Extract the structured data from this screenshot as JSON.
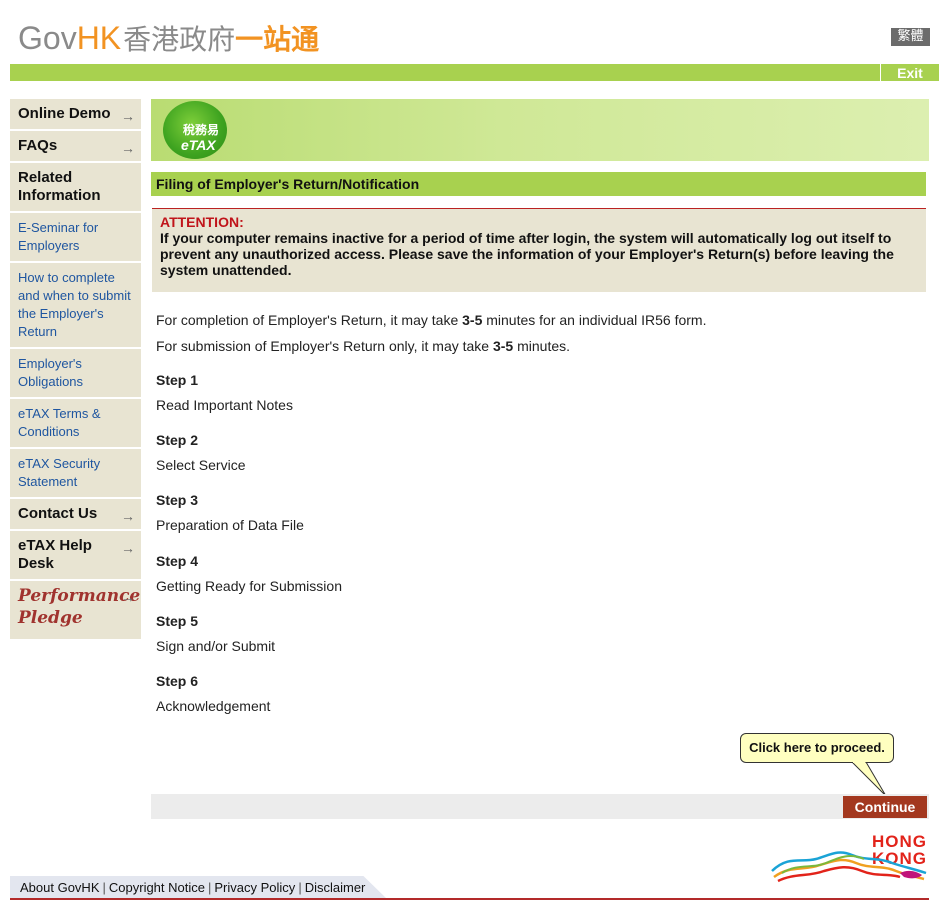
{
  "header": {
    "logo_gov": "Gov",
    "logo_hk": "HK",
    "logo_zh_grey": "香港政府",
    "logo_zh_orange": "一站通",
    "lang_button": "繁體",
    "exit_button": "Exit"
  },
  "sidebar": {
    "online_demo": "Online Demo",
    "faqs": "FAQs",
    "related_information": "Related Information",
    "links": [
      "E-Seminar for Employers",
      "How to complete and when to submit the Employer's Return",
      "Employer's Obligations",
      "eTAX Terms & Conditions",
      "eTAX Security Statement"
    ],
    "contact_us": "Contact Us",
    "etax_help_desk": "eTAX Help Desk",
    "performance_pledge": [
      "Performance",
      "Pledge"
    ],
    "arrow": "→"
  },
  "banner": {
    "etax_zh": "稅務易",
    "etax_en": "eTAX"
  },
  "page_title": "Filing of Employer's Return/Notification",
  "attention": {
    "title": "ATTENTION:",
    "body": "If your computer remains inactive for a period of time after login, the system will automatically log out itself to prevent any unauthorized access. Please save the information of your Employer's Return(s) before leaving the system unattended."
  },
  "intro": {
    "line1_pre": "For completion of Employer's Return, it may take ",
    "line1_bold": "3-5",
    "line1_post": " minutes for an individual IR56 form.",
    "line2_pre": "For submission of Employer's Return only, it may take ",
    "line2_bold": "3-5",
    "line2_post": " minutes."
  },
  "steps": [
    {
      "heading": "Step 1",
      "desc": "Read Important Notes"
    },
    {
      "heading": "Step 2",
      "desc": "Select Service"
    },
    {
      "heading": "Step 3",
      "desc": "Preparation of Data File"
    },
    {
      "heading": "Step 4",
      "desc": "Getting Ready for Submission"
    },
    {
      "heading": "Step 5",
      "desc": "Sign and/or Submit"
    },
    {
      "heading": "Step 6",
      "desc": "Acknowledgement"
    }
  ],
  "callout": "Click here to proceed.",
  "continue_button": "Continue",
  "footer": {
    "links": [
      "About GovHK",
      "Copyright Notice",
      "Privacy Policy",
      "Disclaimer"
    ],
    "separator": "|",
    "hk_logo": [
      "HONG",
      "KONG"
    ]
  },
  "colors": {
    "green": "#a8d14f",
    "beige": "#e8e4d2",
    "attention_red": "#c0141a",
    "continue_bg": "#a3381f",
    "link_blue": "#1f56a0"
  }
}
